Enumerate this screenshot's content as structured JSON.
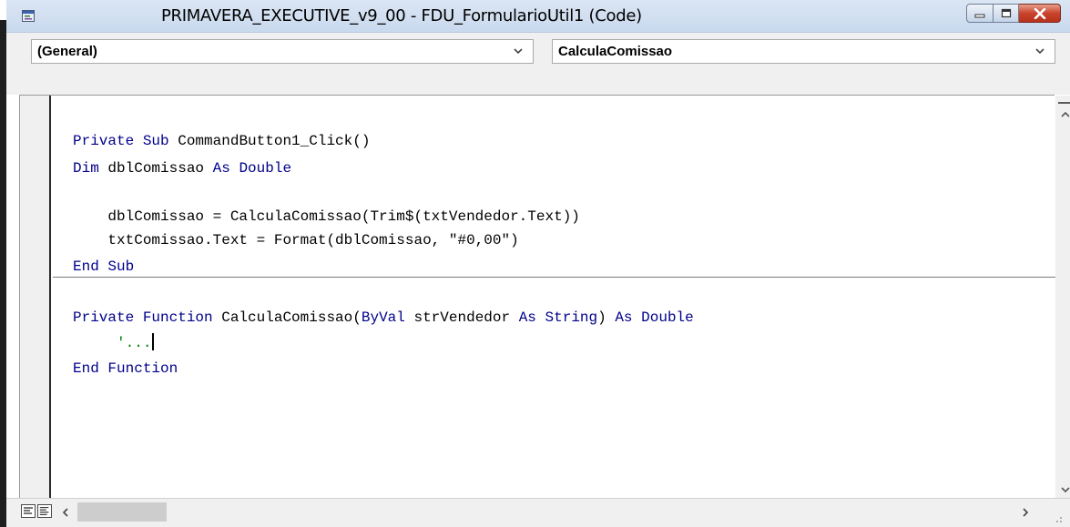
{
  "window": {
    "title": "PRIMAVERA_EXECUTIVE_v9_00 - FDU_FormularioUtil1 (Code)",
    "icons": [
      "app-icon",
      "minimize-icon",
      "maximize-icon",
      "close-icon"
    ]
  },
  "combos": {
    "object_value": "(General)",
    "procedure_value": "CalculaComissao"
  },
  "code": {
    "line1": {
      "kw1": "Private Sub",
      "rest": " CommandButton1_Click()"
    },
    "line2": {
      "kw1": "Dim",
      "mid": " dblComissao ",
      "kw2": "As Double"
    },
    "line3": {
      "text": "    dblComissao = CalculaComissao(Trim$(txtVendedor.Text))"
    },
    "line4": {
      "text": "    txtComissao.Text = Format(dblComissao, \"#0,00\")"
    },
    "line5": {
      "kw1": "End Sub"
    },
    "line6": {
      "kw1": "Private Function",
      "mid1": " CalculaComissao(",
      "kw2": "ByVal",
      "mid2": " strVendedor ",
      "kw3": "As String",
      "mid3": ") ",
      "kw4": "As Double"
    },
    "line7": {
      "indent": "     ",
      "comment": "'..."
    },
    "line8": {
      "kw1": "End Function"
    }
  },
  "colors": {
    "keyword": "#00008b",
    "comment": "#008000",
    "titlebar": "#c9d9ee",
    "close_button": "#c8432b"
  }
}
